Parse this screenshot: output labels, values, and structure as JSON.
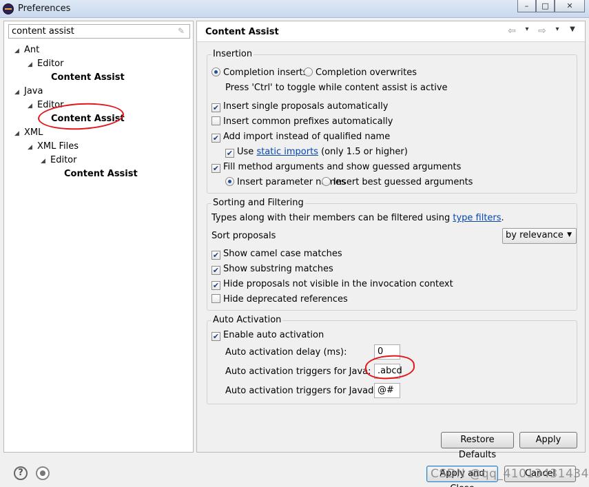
{
  "window": {
    "title": "Preferences",
    "controls": {
      "minimize": "–",
      "maximize": "□",
      "close": "✕"
    }
  },
  "filter": {
    "value": "content assist"
  },
  "tree": [
    {
      "label": "Ant",
      "bold": false,
      "expanded": true
    },
    {
      "label": "Editor",
      "bold": false,
      "expanded": true
    },
    {
      "label": "Content Assist",
      "bold": true
    },
    {
      "label": "Java",
      "bold": false,
      "expanded": true
    },
    {
      "label": "Editor",
      "bold": false,
      "expanded": true
    },
    {
      "label": "Content Assist",
      "bold": true,
      "selected": true
    },
    {
      "label": "XML",
      "bold": false,
      "expanded": true
    },
    {
      "label": "XML Files",
      "bold": false,
      "expanded": true
    },
    {
      "label": "Editor",
      "bold": false,
      "expanded": true
    },
    {
      "label": "Content Assist",
      "bold": true
    }
  ],
  "page": {
    "title": "Content Assist",
    "nav": {
      "back": "⇦",
      "forward": "⇨",
      "menu": "▼"
    }
  },
  "insertion": {
    "title": "Insertion",
    "radio_completion_inserts": "Completion inserts",
    "radio_completion_overwrites": "Completion overwrites",
    "hint": "Press 'Ctrl' to toggle while content assist is active",
    "insert_single": "Insert single proposals automatically",
    "insert_common": "Insert common prefixes automatically",
    "add_import": "Add import instead of qualified name",
    "use_prefix": "Use",
    "static_imports": "static imports",
    "use_suffix": "(only 1.5 or higher)",
    "fill_method": "Fill method arguments and show guessed arguments",
    "insert_param_names": "Insert parameter names",
    "insert_best_guessed": "Insert best guessed arguments"
  },
  "sorting": {
    "title": "Sorting and Filtering",
    "types_text": "Types along with their members can be filtered using",
    "type_filters": "type filters",
    "period": ".",
    "sort_label": "Sort proposals",
    "sort_value": "by relevance",
    "camel": "Show camel case matches",
    "substring": "Show substring matches",
    "hide_not_visible": "Hide proposals not visible in the invocation context",
    "hide_deprecated": "Hide deprecated references"
  },
  "auto": {
    "title": "Auto Activation",
    "enable": "Enable auto activation",
    "delay_label": "Auto activation delay (ms):",
    "delay_value": "0",
    "java_label": "Auto activation triggers for Java:",
    "java_value": ".abcd",
    "javadoc_label": "Auto activation triggers for Javadoc:",
    "javadoc_value": "@#"
  },
  "buttons": {
    "restore": "Restore Defaults",
    "apply": "Apply",
    "apply_close": "Apply and Close",
    "cancel": "Cancel"
  },
  "watermark": "CSDN @qq_41013431434",
  "checked": "✔"
}
